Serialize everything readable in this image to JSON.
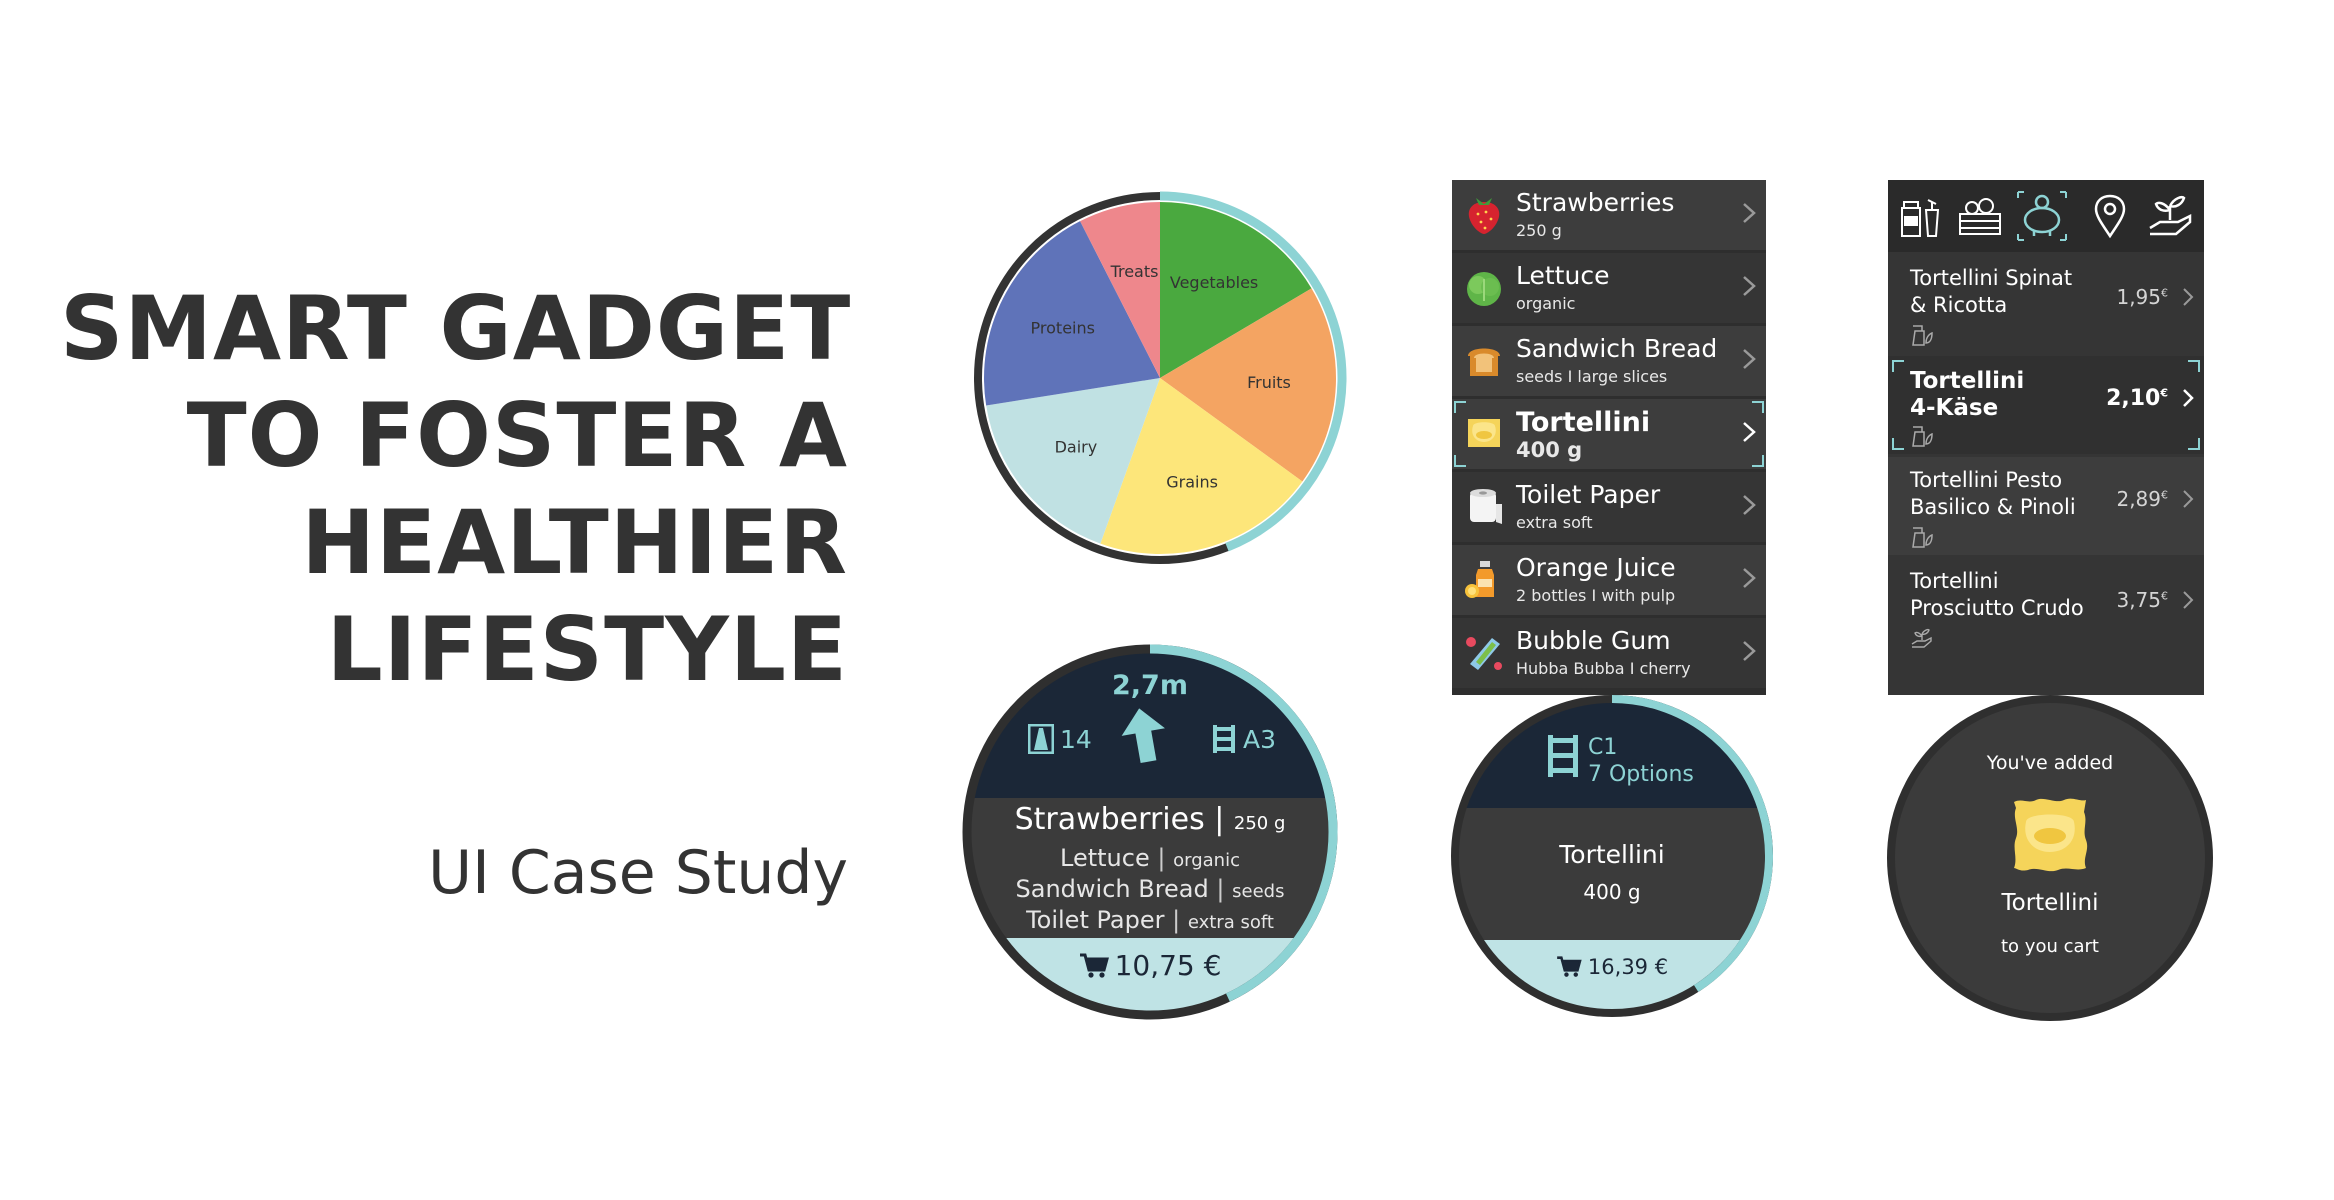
{
  "title_lines": [
    "SMART GADGET",
    "TO FOSTER A",
    "HEALTHIER",
    "LIFESTYLE"
  ],
  "subtitle": "UI Case Study",
  "colors": {
    "teal": "#8dd3d4",
    "navy": "#1b2737",
    "watch_body": "#3b3b3b",
    "light_teal": "#bfe3e5",
    "pie_vegetables": "#4aa93f",
    "pie_fruits": "#f4a462",
    "pie_grains": "#fde67a",
    "pie_dairy": "#c0e1e3",
    "pie_proteins": "#5f73b9",
    "pie_treats": "#ee878c"
  },
  "pie": {
    "slices": [
      {
        "label": "Vegetables",
        "percent": 16.5
      },
      {
        "label": "Fruits",
        "percent": 18.5
      },
      {
        "label": "Grains",
        "percent": 20.5
      },
      {
        "label": "Dairy",
        "percent": 17.0
      },
      {
        "label": "Proteins",
        "percent": 20.0
      },
      {
        "label": "Treats",
        "percent": 7.5
      }
    ],
    "ring_progress_percent": 44
  },
  "nav_watch": {
    "distance": "2,7m",
    "aisle": "14",
    "shelf": "A3",
    "main_item": "Strawberries |",
    "main_qty": "250 g",
    "items": [
      {
        "name": "Lettuce",
        "sep": "|",
        "note": "organic"
      },
      {
        "name": "Sandwich Bread",
        "sep": "|",
        "note": "seeds"
      },
      {
        "name": "Toilet Paper",
        "sep": "|",
        "note": "extra soft"
      }
    ],
    "total": "10,75 €",
    "ring_progress_percent": 43
  },
  "shopping_list": [
    {
      "name": "Strawberries",
      "sub": "250 g",
      "icon": "strawberry-icon"
    },
    {
      "name": "Lettuce",
      "sub": "organic",
      "icon": "lettuce-icon"
    },
    {
      "name": "Sandwich Bread",
      "sub": "seeds I large slices",
      "icon": "bread-icon"
    },
    {
      "name": "Tortellini",
      "sub": "400 g",
      "icon": "tortellini-icon",
      "selected": true
    },
    {
      "name": "Toilet Paper",
      "sub": "extra soft",
      "icon": "toilet-paper-icon"
    },
    {
      "name": "Orange Juice",
      "sub": "2 bottles I with pulp",
      "icon": "orange-juice-icon"
    },
    {
      "name": "Bubble Gum",
      "sub": "Hubba Bubba I cherry",
      "icon": "bubble-gum-icon"
    }
  ],
  "location_watch": {
    "code": "C1",
    "options": "7 Options",
    "item": "Tortellini",
    "qty": "400 g",
    "total": "16,39 €",
    "ring_progress_percent": 41
  },
  "pasta_tabs": [
    "grocery-bag-icon",
    "produce-crate-icon",
    "piggy-bank-icon",
    "location-pin-icon",
    "plant-hand-icon"
  ],
  "pasta_options": [
    {
      "name_lines": [
        "Tortellini Spinat",
        "& Ricotta"
      ],
      "price": "1,95",
      "currency": "€",
      "icon": "vegetarian-icon"
    },
    {
      "name_lines": [
        "Tortellini",
        "4-Käse"
      ],
      "price": "2,10",
      "currency": "€",
      "icon": "vegetarian-icon",
      "selected": true
    },
    {
      "name_lines": [
        "Tortellini Pesto",
        "Basilico & Pinoli"
      ],
      "price": "2,89",
      "currency": "€",
      "icon": "vegetarian-icon"
    },
    {
      "name_lines": [
        "Tortellini",
        "Prosciutto Crudo"
      ],
      "price": "3,75",
      "currency": "€",
      "icon": "sustainable-icon"
    }
  ],
  "added_watch": {
    "heading": "You've added",
    "item": "Tortellini",
    "footer": "to you cart"
  }
}
